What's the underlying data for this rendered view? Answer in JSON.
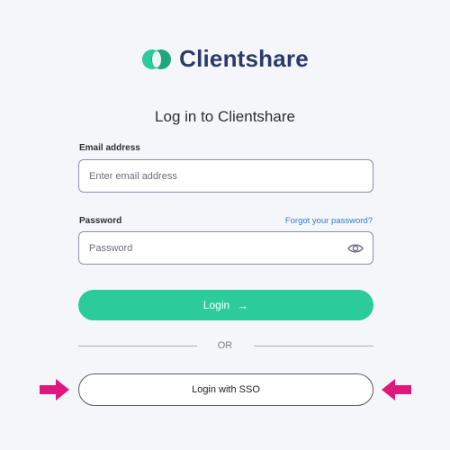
{
  "brand": {
    "name": "Clientshare"
  },
  "heading": "Log in to Clientshare",
  "email": {
    "label": "Email address",
    "placeholder": "Enter email address",
    "value": ""
  },
  "password": {
    "label": "Password",
    "placeholder": "Password",
    "value": "",
    "forgot_link": "Forgot your password?",
    "toggle_icon": "eye-icon"
  },
  "login_button": {
    "label": "Login",
    "icon": "arrow-right-icon"
  },
  "divider": {
    "label": "OR"
  },
  "sso_button": {
    "label": "Login with SSO"
  },
  "annotations": {
    "icon": "pointer-arrow-icon",
    "color": "#e0177d"
  },
  "colors": {
    "brand_dark": "#2b3a6b",
    "brand_green": "#2bcb9b",
    "link": "#2f7cc9"
  }
}
